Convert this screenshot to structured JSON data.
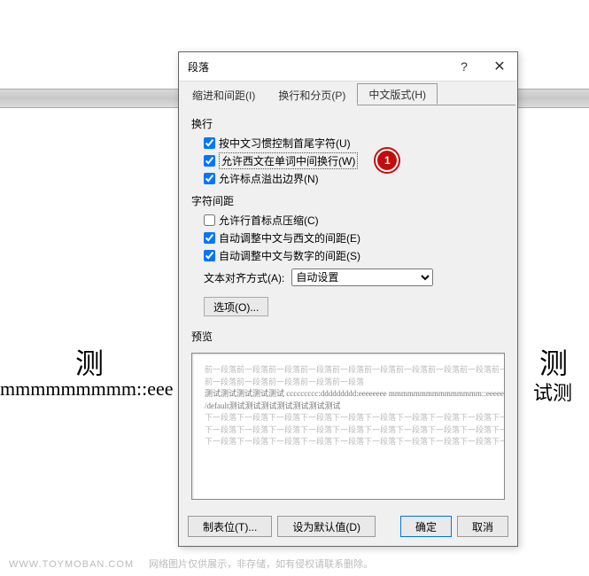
{
  "dialog": {
    "title": "段落",
    "help": "?",
    "close": "✕"
  },
  "tabs": [
    {
      "label": "缩进和间距(I)"
    },
    {
      "label": "换行和分页(P)"
    },
    {
      "label": "中文版式(H)",
      "active": true
    }
  ],
  "sections": {
    "linebreak": {
      "label": "换行",
      "opts": [
        {
          "label": "按中文习惯控制首尾字符(U)",
          "checked": true
        },
        {
          "label": "允许西文在单词中间换行(W)",
          "checked": true,
          "highlight": true,
          "marker": "1"
        },
        {
          "label": "允许标点溢出边界(N)",
          "checked": true
        }
      ]
    },
    "spacing": {
      "label": "字符间距",
      "opts": [
        {
          "label": "允许行首标点压缩(C)",
          "checked": false
        },
        {
          "label": "自动调整中文与西文的间距(E)",
          "checked": true
        },
        {
          "label": "自动调整中文与数字的间距(S)",
          "checked": true
        }
      ]
    },
    "align": {
      "label": "文本对齐方式(A):",
      "value": "自动设置"
    },
    "options_btn": "选项(O)..."
  },
  "preview": {
    "label": "预览",
    "lines": {
      "faint1": "前一段落前一段落前一段落前一段落前一段落前一段落前一段落前一段落前一段落前一段落",
      "faint2": "前一段落前一段落前一段落前一段落前一段落",
      "dark1": "测试测试测试测试测试 ccccccccc:ddddddddd:eeeeeeee mmmmmmmmmmmmmmm::eeeeeeee",
      "dark2": "/default测试测试测试测试测试测试测试",
      "faint3": "下一段落下一段落下一段落下一段落下一段落下一段落下一段落下一段落下一段落下一段落",
      "faint4": "下一段落下一段落下一段落下一段落下一段落下一段落下一段落下一段落下一段落下一段落",
      "faint5": "下一段落下一段落下一段落下一段落下一段落下一段落下一段落下一段落下一段落下一段落"
    }
  },
  "footer": {
    "tabstops": "制表位(T)...",
    "set_default": "设为默认值(D)",
    "ok": "确定",
    "cancel": "取消"
  },
  "background": {
    "ce": "测",
    "mm": "mmmmmmmmm::eee",
    "sh": "试测"
  },
  "watermark": {
    "domain": "WWW.TOYMOBAN.COM",
    "text": "网络图片仅供展示，非存储，如有侵权请联系删除。"
  }
}
